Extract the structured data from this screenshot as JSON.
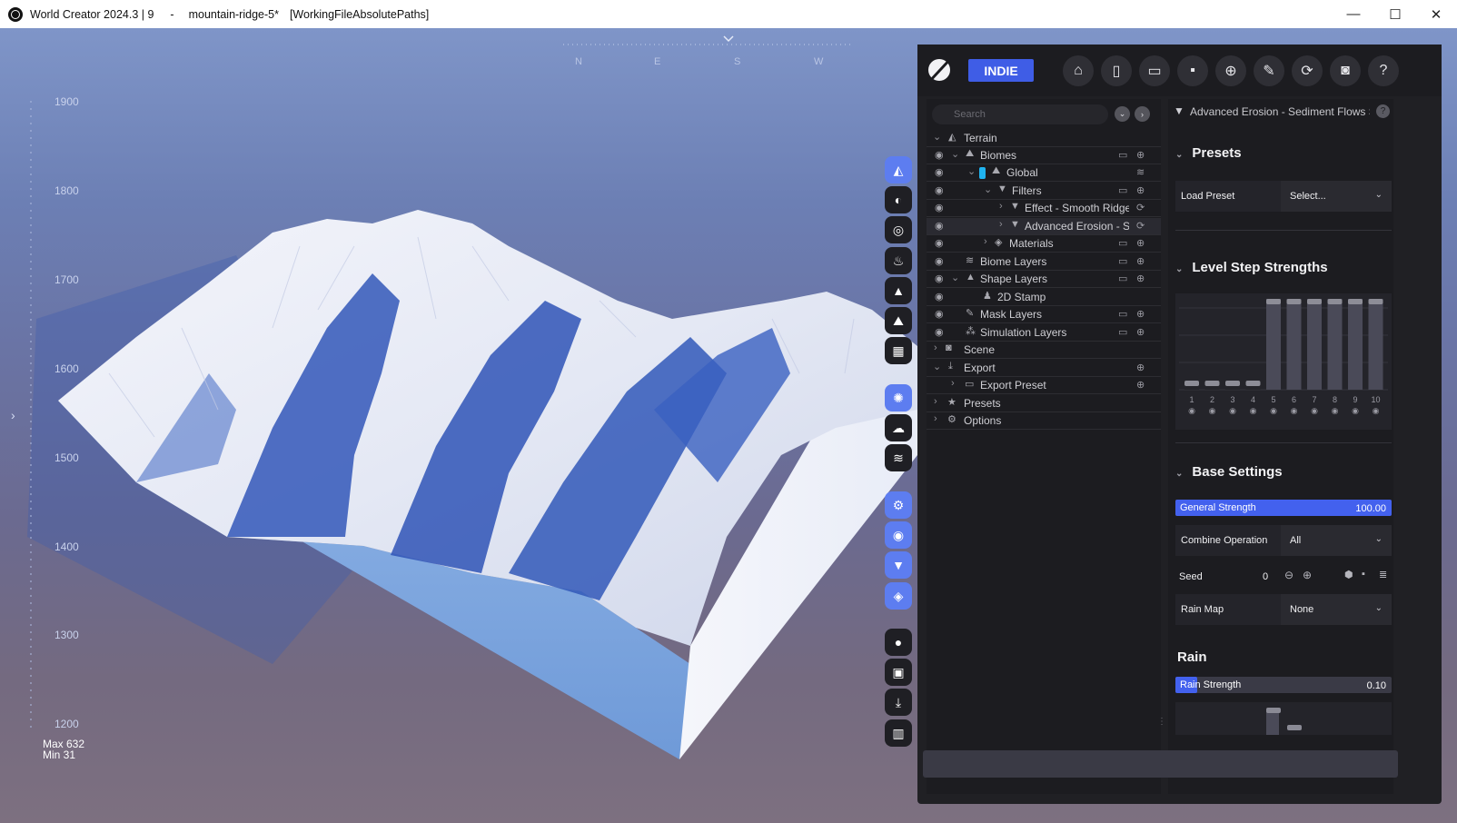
{
  "titlebar": {
    "app": "World Creator 2024.3 | 9",
    "separator": "-",
    "file": "mountain-ridge-5*",
    "mode": "[WorkingFileAbsolutePaths]",
    "minimize": "—",
    "maximize": "☐",
    "close": "✕"
  },
  "viewport": {
    "compass": [
      "N",
      "E",
      "S",
      "W"
    ],
    "height_scale": [
      "1900",
      "1800",
      "1700",
      "1600",
      "1500",
      "1400",
      "1300",
      "1200"
    ],
    "max_label": "Max 632",
    "min_label": "Min 31",
    "left_toggle": "›"
  },
  "toolbar_icons": [
    "terrain-icon",
    "biome-icon",
    "noise-icon",
    "water-icon",
    "mountain-icon",
    "sediment-icon",
    "grid-icon",
    "sun-icon",
    "cloud-icon",
    "layers-icon",
    "settings-icon",
    "visibility-icon",
    "filter-icon",
    "stack-icon",
    "record-icon",
    "image-icon",
    "download-icon",
    "chart-icon"
  ],
  "panel": {
    "badge": "INDIE",
    "top_buttons": [
      "home-icon",
      "new-file-icon",
      "open-folder-icon",
      "save-icon",
      "save-as-icon",
      "edit-icon",
      "refresh-icon",
      "camera-icon",
      "help-icon"
    ]
  },
  "tree": {
    "search_placeholder": "Search",
    "rows": [
      {
        "label": "Terrain",
        "expanded": true
      },
      {
        "label": "Biomes",
        "expanded": true
      },
      {
        "label": "Global",
        "expanded": true
      },
      {
        "label": "Filters",
        "expanded": true
      },
      {
        "label": "Effect - Smooth Ridge"
      },
      {
        "label": "Advanced Erosion - Se",
        "selected": true
      },
      {
        "label": "Materials"
      },
      {
        "label": "Biome Layers"
      },
      {
        "label": "Shape Layers",
        "expanded": true
      },
      {
        "label": "2D Stamp"
      },
      {
        "label": "Mask Layers"
      },
      {
        "label": "Simulation Layers"
      },
      {
        "label": "Scene"
      },
      {
        "label": "Export",
        "expanded": true
      },
      {
        "label": "Export Preset"
      },
      {
        "label": "Presets"
      },
      {
        "label": "Options"
      }
    ]
  },
  "props": {
    "header": "Advanced Erosion - Sediment Flows Se",
    "presets": {
      "title": "Presets",
      "load_label": "Load Preset",
      "select_value": "Select..."
    },
    "level_steps": {
      "title": "Level Step Strengths",
      "labels": [
        "1",
        "2",
        "3",
        "4",
        "5",
        "6",
        "7",
        "8",
        "9",
        "10"
      ],
      "values": [
        0.1,
        0.1,
        0.1,
        0.1,
        1,
        1,
        1,
        1,
        1,
        1
      ]
    },
    "base_settings": {
      "title": "Base Settings",
      "general_strength_label": "General Strength",
      "general_strength_value": "100.00",
      "general_strength_fraction": 1.0,
      "combine_label": "Combine Operation",
      "combine_value": "All",
      "seed_label": "Seed",
      "seed_value": "0",
      "rain_map_label": "Rain Map",
      "rain_map_value": "None"
    },
    "rain": {
      "title": "Rain",
      "strength_label": "Rain Strength",
      "strength_value": "0.10",
      "strength_fraction": 0.1
    }
  },
  "colors": {
    "accent": "#3f5de6",
    "panel_bg": "#1c1c20",
    "toolbar_blue": "#4f6fe6"
  }
}
